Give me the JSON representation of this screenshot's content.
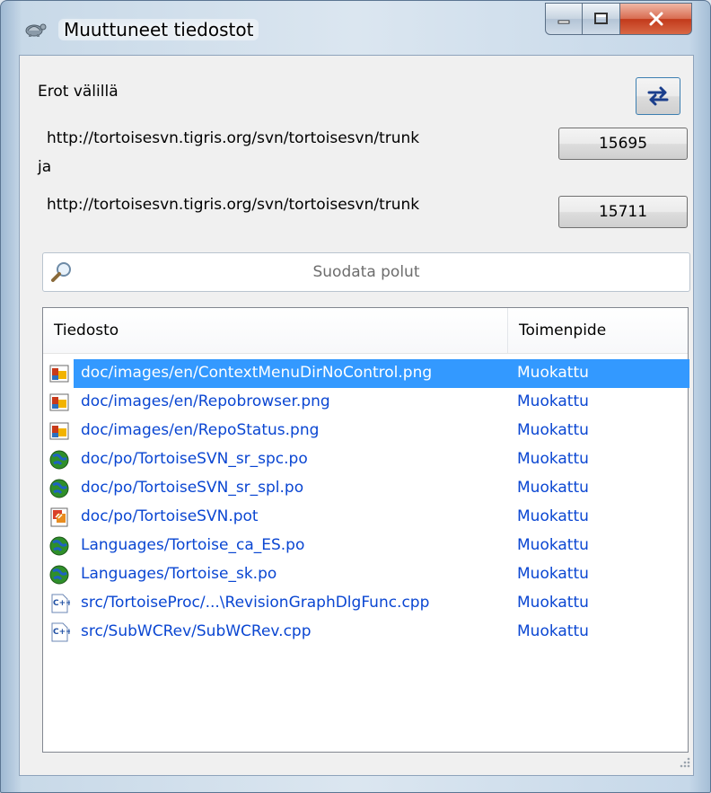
{
  "window": {
    "title": "Muuttuneet tiedostot",
    "app_icon": "tortoise-icon"
  },
  "caption_buttons": {
    "minimize": "minimize-icon",
    "maximize": "maximize-icon",
    "close": "close-icon"
  },
  "compare": {
    "label": "Erot välillä",
    "url1": "http://tortoisesvn.tigris.org/svn/tortoisesvn/trunk",
    "conjunction": "ja",
    "url2": "http://tortoisesvn.tigris.org/svn/tortoisesvn/trunk",
    "rev1": "15695",
    "rev2": "15711",
    "swap_icon": "swap-arrows-icon"
  },
  "filter": {
    "placeholder": "Suodata polut",
    "icon": "search-icon"
  },
  "list": {
    "columns": [
      "Tiedosto",
      "Toimenpide"
    ],
    "selected_index": 0,
    "rows": [
      {
        "path": "doc/images/en/ContextMenuDirNoControl.png",
        "action": "Muokattu",
        "icon": "png-image-icon"
      },
      {
        "path": "doc/images/en/Repobrowser.png",
        "action": "Muokattu",
        "icon": "png-image-icon"
      },
      {
        "path": "doc/images/en/RepoStatus.png",
        "action": "Muokattu",
        "icon": "png-image-icon"
      },
      {
        "path": "doc/po/TortoiseSVN_sr_spc.po",
        "action": "Muokattu",
        "icon": "po-globe-icon"
      },
      {
        "path": "doc/po/TortoiseSVN_sr_spl.po",
        "action": "Muokattu",
        "icon": "po-globe-icon"
      },
      {
        "path": "doc/po/TortoiseSVN.pot",
        "action": "Muokattu",
        "icon": "pot-file-icon"
      },
      {
        "path": "Languages/Tortoise_ca_ES.po",
        "action": "Muokattu",
        "icon": "po-globe-icon"
      },
      {
        "path": "Languages/Tortoise_sk.po",
        "action": "Muokattu",
        "icon": "po-globe-icon"
      },
      {
        "path": "src/TortoiseProc/...\\RevisionGraphDlgFunc.cpp",
        "action": "Muokattu",
        "icon": "cpp-file-icon"
      },
      {
        "path": "src/SubWCRev/SubWCRev.cpp",
        "action": "Muokattu",
        "icon": "cpp-file-icon"
      }
    ]
  },
  "colors": {
    "selection": "#3399ff",
    "link_text": "#0a46d2",
    "dialog_bg": "#f0f0f0"
  }
}
